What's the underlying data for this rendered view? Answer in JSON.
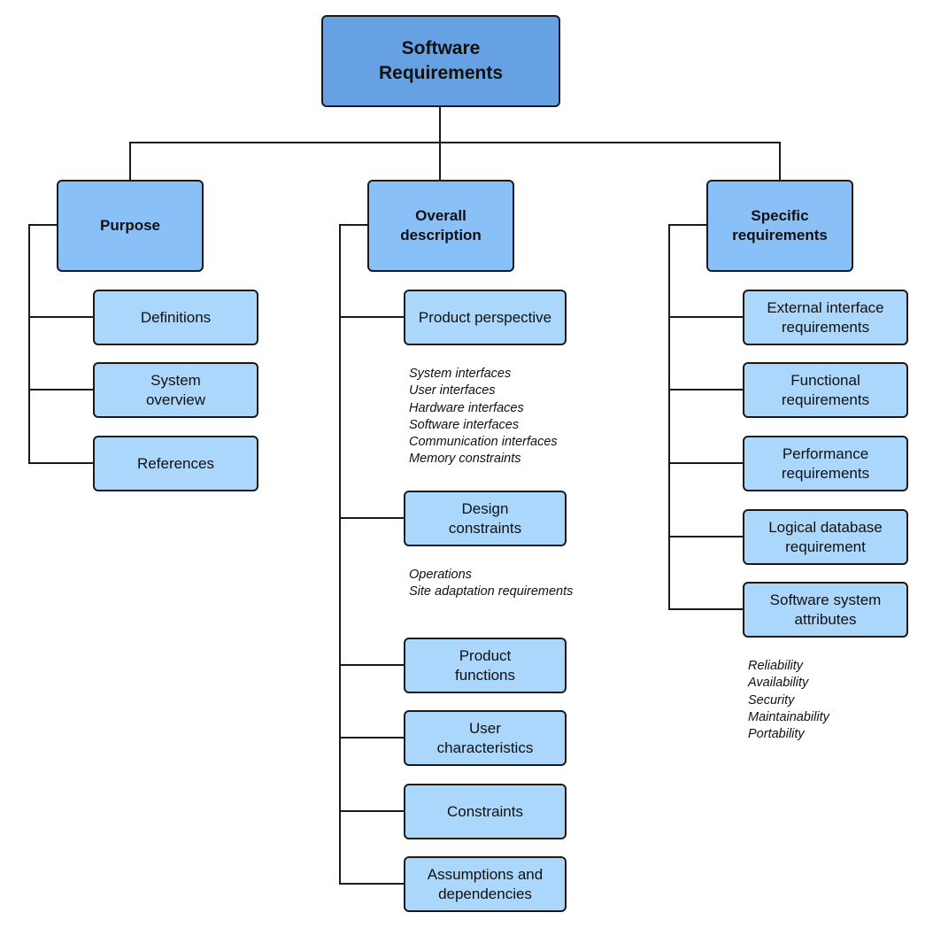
{
  "colors": {
    "root": "#66a1e4",
    "level2": "#8ac0f8",
    "leaf": "#abd7fc",
    "border": "#1a1a1a"
  },
  "root": "Software\nRequirements",
  "purpose": {
    "title": "Purpose",
    "children": [
      "Definitions",
      "System\noverview",
      "References"
    ]
  },
  "overall": {
    "title": "Overall\ndescription",
    "children": [
      "Product perspective",
      "Design\nconstraints",
      "Product\nfunctions",
      "User\ncharacteristics",
      "Constraints",
      "Assumptions and\ndependencies"
    ],
    "notes_product_perspective": "System interfaces\nUser interfaces\nHardware interfaces\nSoftware interfaces\nCommunication interfaces\nMemory constraints",
    "notes_design_constraints": "Operations\nSite adaptation requirements"
  },
  "specific": {
    "title": "Specific\nrequirements",
    "children": [
      "External interface\nrequirements",
      "Functional\nrequirements",
      "Performance\nrequirements",
      "Logical database\nrequirement",
      "Software system\nattributes"
    ],
    "notes_attributes": "Reliability\nAvailability\nSecurity\nMaintainability\nPortability"
  }
}
